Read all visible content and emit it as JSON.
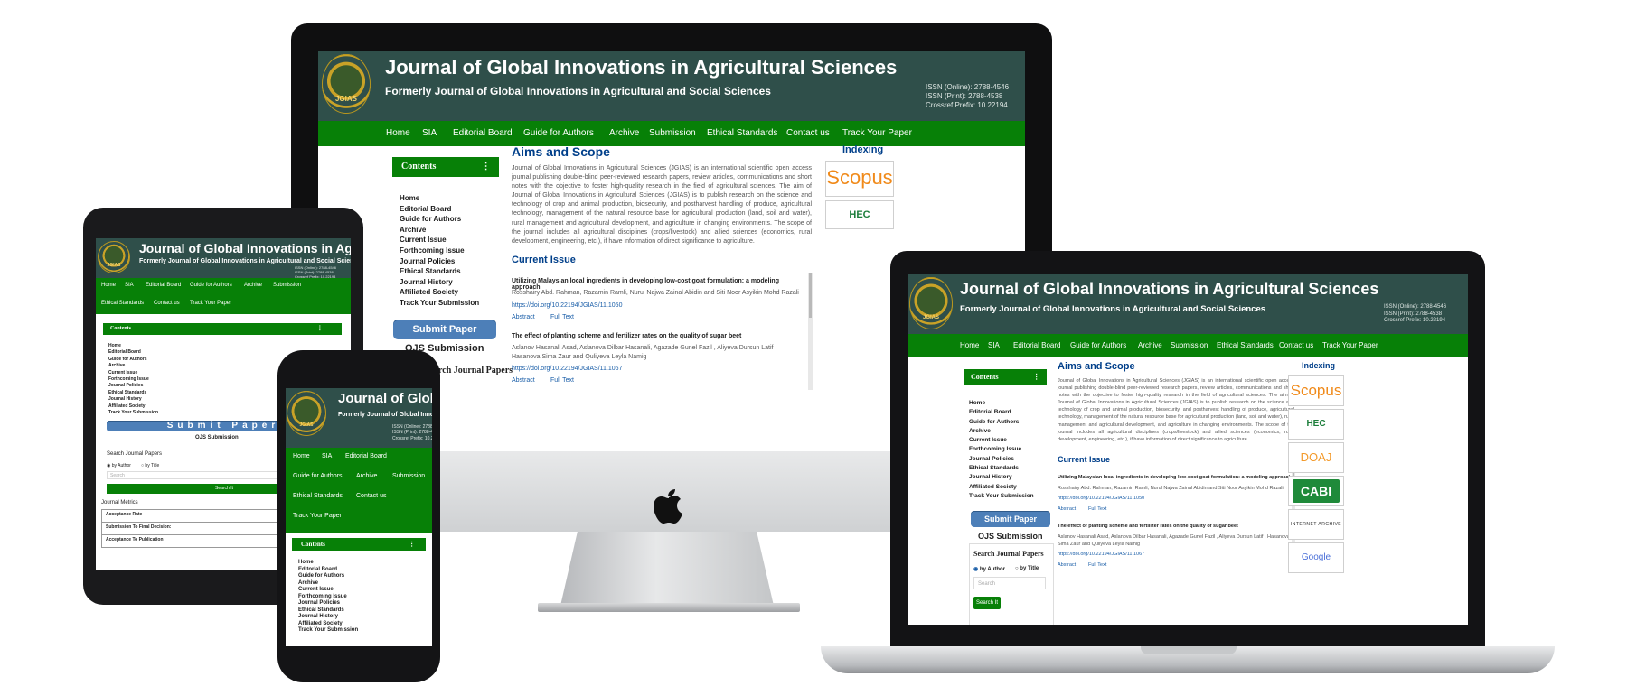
{
  "site": {
    "title": "Journal of Global Innovations in Agricultural Sciences",
    "subtitle": "Formerly Journal of Global Innovations in Agricultural and Social Sciences",
    "logo_text": "JGIAS",
    "issn": {
      "online": "ISSN (Online):    2788-4546",
      "print": "ISSN (Print):       2788-4538",
      "crossref": "Crossref Prefix:   10.22194"
    },
    "nav": [
      "Home",
      "SIA",
      "Editorial Board",
      "Guide for Authors",
      "Archive",
      "Submission",
      "Ethical Standards",
      "Contact us",
      "Track Your Paper"
    ],
    "contents_label": "Contents",
    "menu": [
      "Home",
      "Editorial Board",
      "Guide for Authors",
      "Archive",
      "Current Issue",
      "Forthcoming Issue",
      "Journal Policies",
      "Ethical Standards",
      "Journal History",
      "Affiliated Society",
      "Track Your Submission"
    ],
    "submit_label": "Submit Paper",
    "ojs_label": "OJS Submission",
    "search": {
      "heading": "Search Journal Papers",
      "by_author": "by Author",
      "by_title": "by Title",
      "placeholder": "Search",
      "button": "Search It"
    },
    "aims_heading": "Aims and Scope",
    "aims_text": "Journal of Global Innovations in Agricultural Sciences (JGIAS) is an international scientific open access journal publishing double-blind peer-reviewed research papers, review articles, communications and short notes with the objective to foster high-quality research in the field of agricultural sciences. The aim of Journal of Global Innovations in Agricultural Sciences (JGIAS) is to publish research on the science and technology of crop and animal production, biosecurity, and postharvest handling of produce, agricultural technology, management of the natural resource base for agricultural production (land, soil and water), rural management and agricultural development, and agriculture in changing environments. The scope of the journal includes all agricultural disciplines (crops/livestock) and allied sciences (economics, rural development, engineering, etc.), if have information of direct significance to agriculture.",
    "current_heading": "Current Issue",
    "articles": [
      {
        "title": "Utilizing Malaysian local ingredients in developing low-cost goat formulation: a modeling approach",
        "authors": "Rosshairy Abd. Rahman, Razamin Ramli, Nurul Najwa Zainal Abidin and Siti Noor Asyikin Mohd Razali",
        "doi": "https://doi.org/10.22194/JGIAS/11.1050",
        "abstract": "Abstract",
        "fulltext": "Full Text"
      },
      {
        "title": "The effect of planting scheme and fertilizer rates on the quality of sugar beet",
        "authors": "Aslanov Hasanali Asad, Aslanova Dilbar Hasanali, Agazade Gunel Fazil , Aliyeva Dursun Latif , Hasanova Sima Zaur and Quliyeva Leyla Namig",
        "doi": "https://doi.org/10.22194/JGIAS/11.1067",
        "abstract": "Abstract",
        "fulltext": "Full Text"
      }
    ],
    "laptop_dois": [
      "https://doi.org/10.22194/JGIAS/11.1050",
      "https://doi.org/10.22194/JGIAS/11.1067"
    ],
    "indexing_heading": "Indexing",
    "indexing": [
      "Scopus",
      "HEC",
      "DOAJ",
      "CABI",
      "INTERNET ARCHIVE",
      "Google Scholar"
    ],
    "metrics_heading": "Journal Metrics",
    "metrics": [
      "Acceptance Rate",
      "Submission To Final Decision:",
      "Acceptance To Publication"
    ]
  },
  "colors": {
    "header": "#2f4f4a",
    "nav": "#078007",
    "heading_blue": "#003f8a",
    "button_blue": "#4d7fb8"
  },
  "icons": [
    "apple-logo-icon",
    "chevron-down-icon",
    "radio-icon"
  ]
}
